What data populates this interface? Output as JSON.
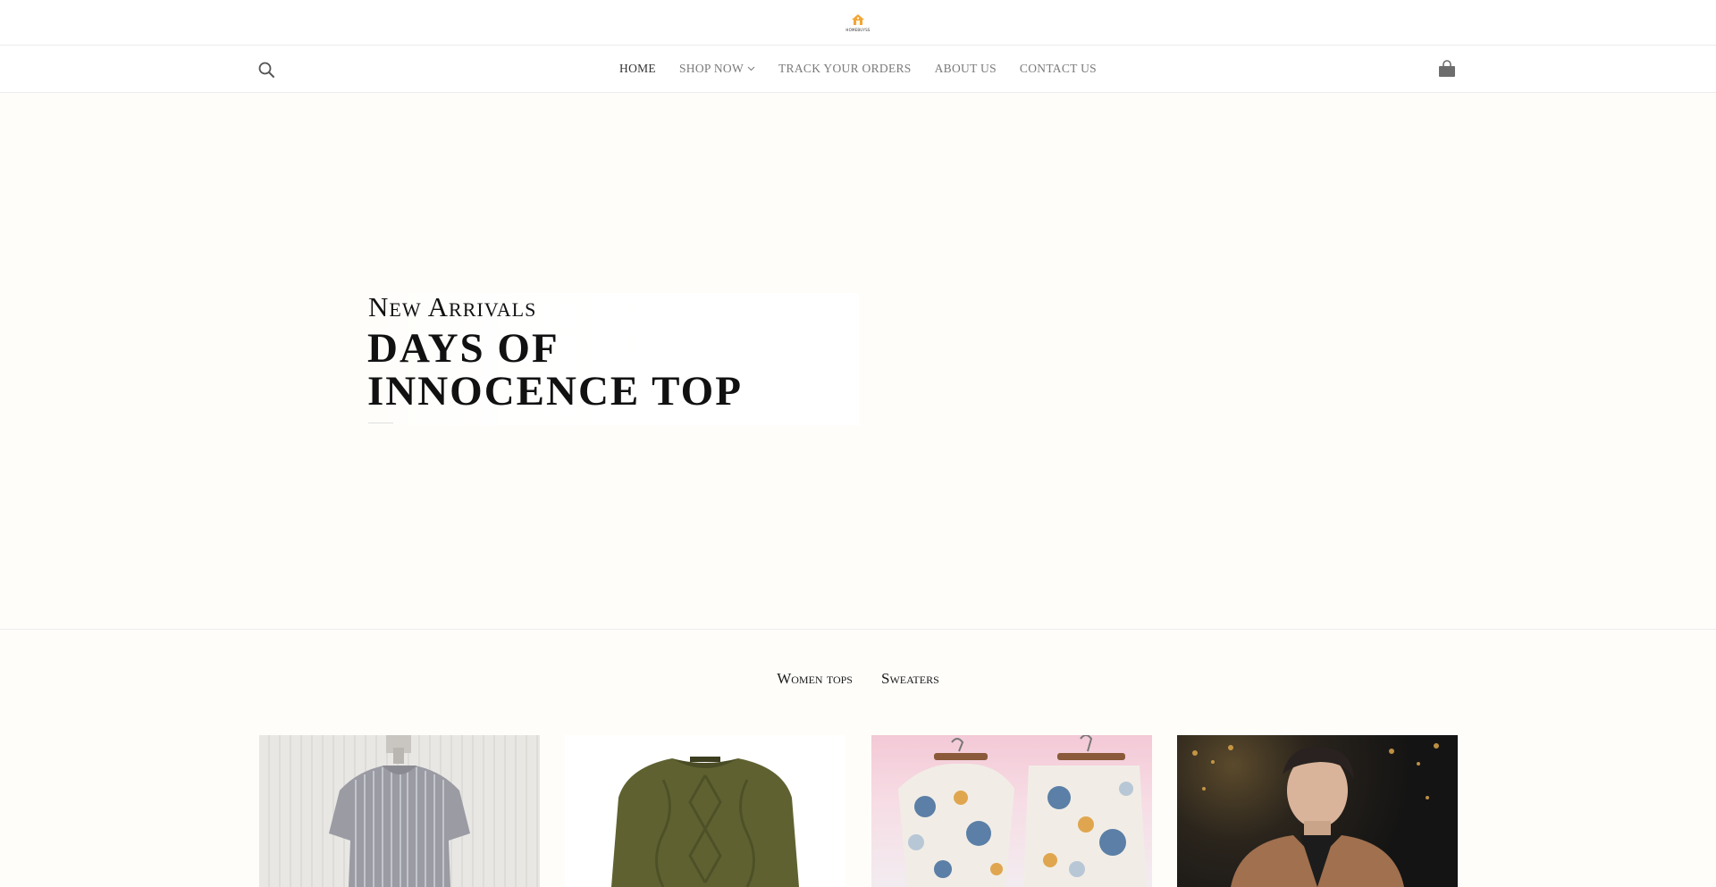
{
  "brand": {
    "logo_text": "HOMEBUYSS",
    "logo_icon": "house-logo-icon"
  },
  "nav": {
    "search_icon": "search-icon",
    "items": [
      {
        "label": "HOME",
        "active": true
      },
      {
        "label": "SHOP NOW",
        "has_dropdown": true
      },
      {
        "label": "TRACK YOUR ORDERS"
      },
      {
        "label": "ABOUT US"
      },
      {
        "label": "CONTACT US"
      }
    ],
    "cart_icon": "shopping-bag-icon"
  },
  "hero": {
    "kicker": "New Arrivals",
    "title": "DAYS OF INNOCENCE TOP"
  },
  "category_tabs": [
    {
      "label": "Women tops"
    },
    {
      "label": "Sweaters"
    }
  ],
  "products": [
    {
      "image": "striped-linen-top-on-dress-form"
    },
    {
      "image": "olive-cable-knit-sweater"
    },
    {
      "image": "floral-print-shirt-and-shorts-set"
    },
    {
      "image": "man-in-brown-leather-jacket"
    }
  ],
  "colors": {
    "page_background": "#fefdfa",
    "nav_text": "#7a7a7a",
    "nav_active": "#333333",
    "logo_accent": "#f3a536"
  }
}
